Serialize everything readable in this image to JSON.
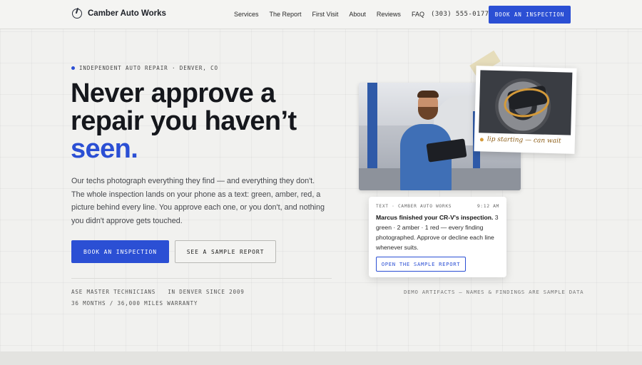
{
  "nav": {
    "brand": "Camber Auto Works",
    "links": [
      "Services",
      "The Report",
      "First Visit",
      "About",
      "Reviews",
      "FAQ"
    ],
    "phone": "(303) 555-0177",
    "cta": "BOOK AN INSPECTION"
  },
  "hero": {
    "eyebrow": "INDEPENDENT AUTO REPAIR · DENVER, CO",
    "headline_line1": "Never approve a",
    "headline_line2": "repair you haven’t",
    "headline_accent": "seen.",
    "lede": "Our techs photograph everything they find — and everything they don't. The whole inspection lands on your phone as a text: green, amber, red, a picture behind every line. You approve each one, or you don't, and nothing you didn't approve gets touched.",
    "primary_cta": "BOOK AN INSPECTION",
    "secondary_cta": "SEE A SAMPLE REPORT",
    "meta_certs": "ASE MASTER TECHNICIANS",
    "meta_since": "IN DENVER SINCE 2009",
    "meta_warranty": "36 MONTHS / 36,000 MILES WARRANTY"
  },
  "polaroid": {
    "caption": "lip starting — can wait"
  },
  "message": {
    "from": "TEXT · CAMBER AUTO WORKS",
    "time": "9:12 AM",
    "bold": "Marcus finished your CR-V's inspection.",
    "rest": " 3 green · 2 amber · 1 red — every finding photographed. Approve or decline each line whenever suits.",
    "button": "OPEN THE SAMPLE REPORT"
  },
  "demo_note": "DEMO ARTIFACTS — NAMES & FINDINGS ARE SAMPLE DATA",
  "colors": {
    "accent": "#2b4fd4",
    "amber": "#d49a3a",
    "background": "#f1f1ef"
  },
  "icons": {
    "brand": "wrench-circle-icon"
  }
}
